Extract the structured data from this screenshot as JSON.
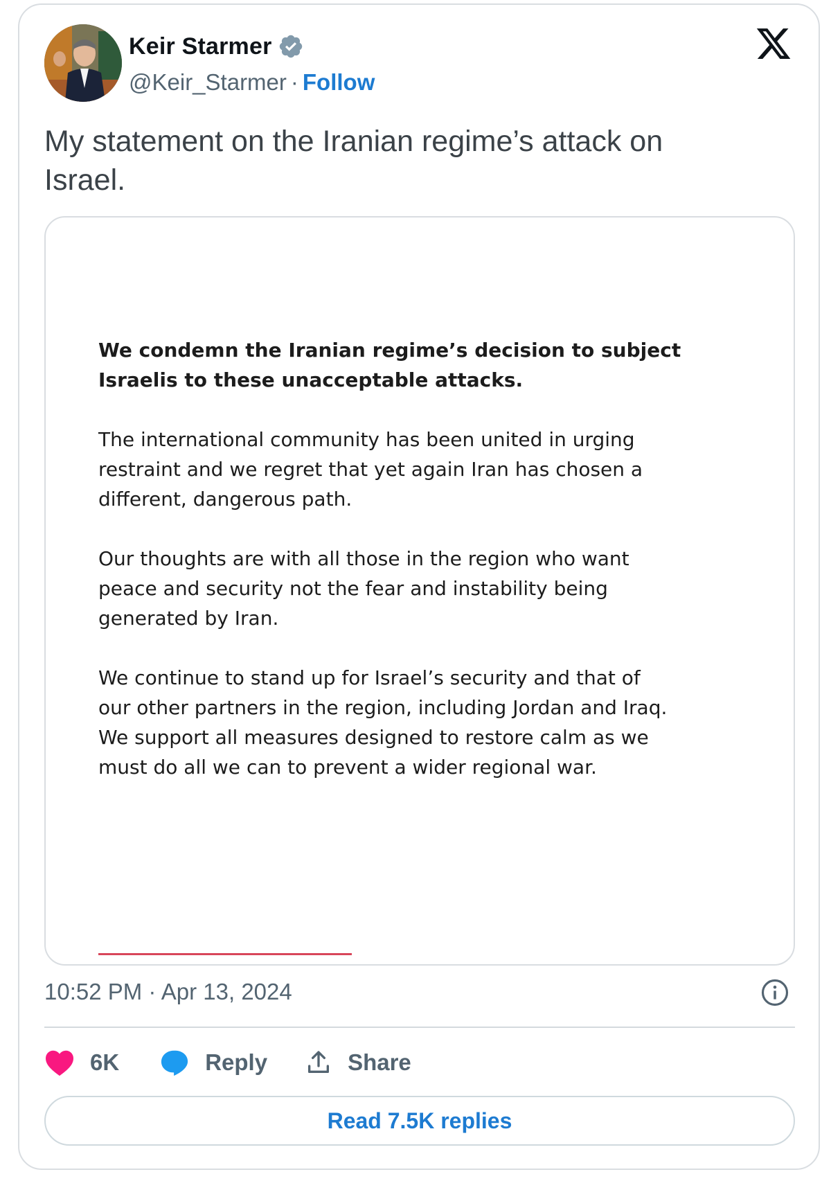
{
  "author": {
    "display_name": "Keir Starmer",
    "handle": "@Keir_Starmer",
    "separator": "·",
    "follow_label": "Follow",
    "verified_icon": "verified-badge-icon",
    "avatar": "profile-photo"
  },
  "platform": {
    "logo_icon": "x-logo-icon"
  },
  "tweet": {
    "text": "My statement on the Iranian regime’s attack on Israel.",
    "timestamp": "10:52 PM · Apr 13, 2024"
  },
  "media": {
    "paragraphs": [
      "We condemn the Iranian regime’s decision to subject\nIsraelis to these unacceptable attacks.",
      "The international community has been united in urging\nrestraint and we regret that yet again Iran has chosen a\ndifferent, dangerous path.",
      "Our thoughts are with all those in the region who want\npeace and security not the fear and instability being\ngenerated by Iran.",
      "We continue to stand up for Israel’s security and that of\nour other partners in the region, including Jordan and Iraq.\nWe support all measures designed to restore calm as we\nmust do all we can to prevent a wider regional war."
    ],
    "accent_color": "#d8465a"
  },
  "actions": {
    "like_count": "6K",
    "reply_label": "Reply",
    "share_label": "Share",
    "read_replies_label": "Read 7.5K replies"
  },
  "colors": {
    "link_blue": "#1d7bd1",
    "like_pink": "#f91880",
    "reply_blue": "#1d9bf0",
    "muted_gray": "#536471",
    "verified_gray": "#829aab"
  }
}
